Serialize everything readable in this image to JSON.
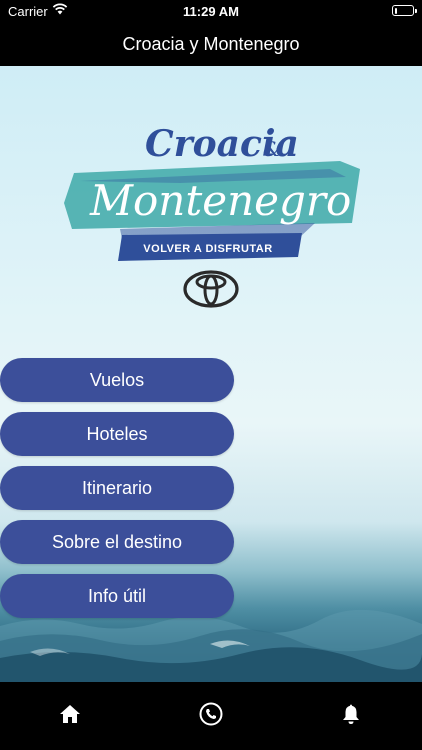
{
  "status_bar": {
    "carrier": "Carrier",
    "time": "11:29 AM",
    "battery_level": 0.1
  },
  "nav": {
    "title": "Croacia y Montenegro"
  },
  "logo": {
    "line1": "Croacia",
    "amp": "&",
    "line2": "Montenegro",
    "tagline": "VOLVER A DISFRUTAR"
  },
  "menu": [
    {
      "label": "Vuelos"
    },
    {
      "label": "Hoteles"
    },
    {
      "label": "Itinerario"
    },
    {
      "label": "Sobre el destino"
    },
    {
      "label": "Info útil"
    }
  ],
  "tabs": [
    {
      "icon": "home-icon"
    },
    {
      "icon": "phone-icon"
    },
    {
      "icon": "bell-icon"
    }
  ],
  "colors": {
    "button": "#3c4f9a",
    "bars": "#000000",
    "logo_blue": "#2f4f9a",
    "logo_teal": "#3ea9a8"
  }
}
